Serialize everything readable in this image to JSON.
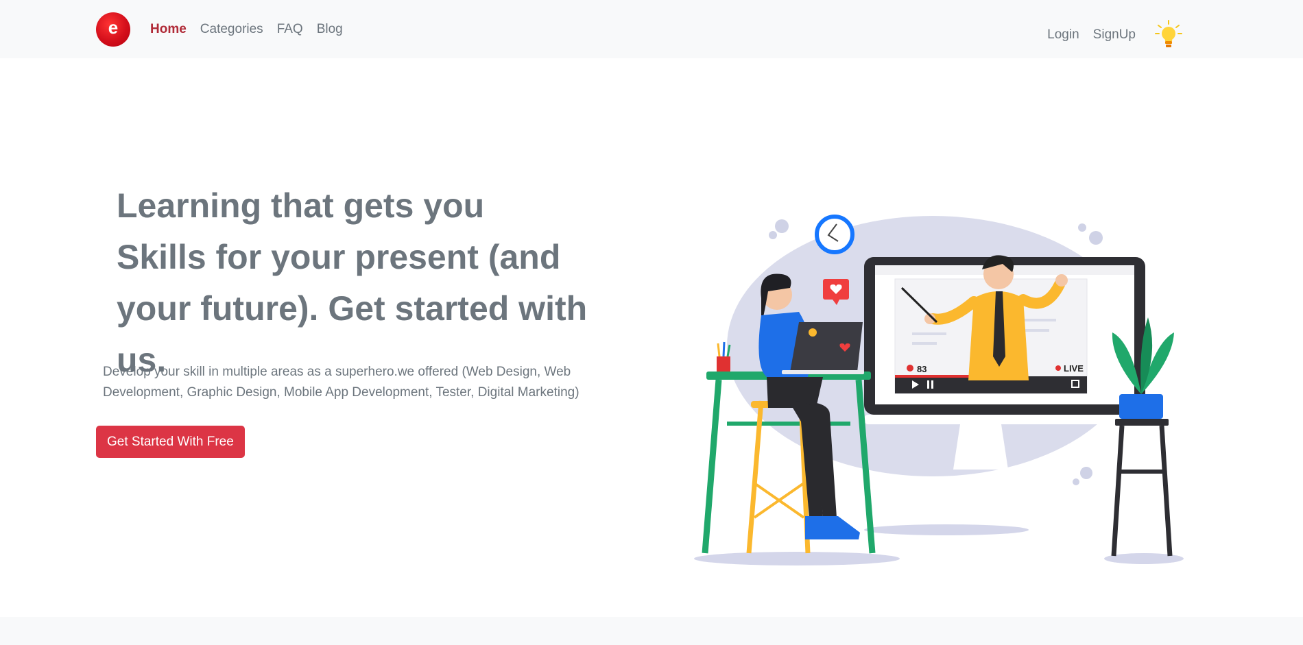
{
  "brand": {
    "logo_letter": "e",
    "color": "#dc1420"
  },
  "nav": {
    "links": [
      {
        "label": "Home",
        "active": true
      },
      {
        "label": "Categories",
        "active": false
      },
      {
        "label": "FAQ",
        "active": false
      },
      {
        "label": "Blog",
        "active": false
      }
    ],
    "login": "Login",
    "signup": "SignUp",
    "theme_icon": "lightbulb-icon"
  },
  "hero": {
    "headline_line1": "Learning that gets you",
    "headline_line2": "Skills for your present (and your future). Get started with us.",
    "description": "Develop your skill in multiple areas as a superhero.we offered (Web Design, Web Development, Graphic Design, Mobile App Development, Tester, Digital Marketing)",
    "cta_label": "Get Started With Free",
    "illustration": {
      "viewer_count": "83",
      "live_label": "LIVE"
    }
  },
  "colors": {
    "accent": "#dc3545",
    "active_nav": "#b02a37",
    "text_muted": "#6c757d",
    "navbar_bg": "#f8f9fa"
  }
}
